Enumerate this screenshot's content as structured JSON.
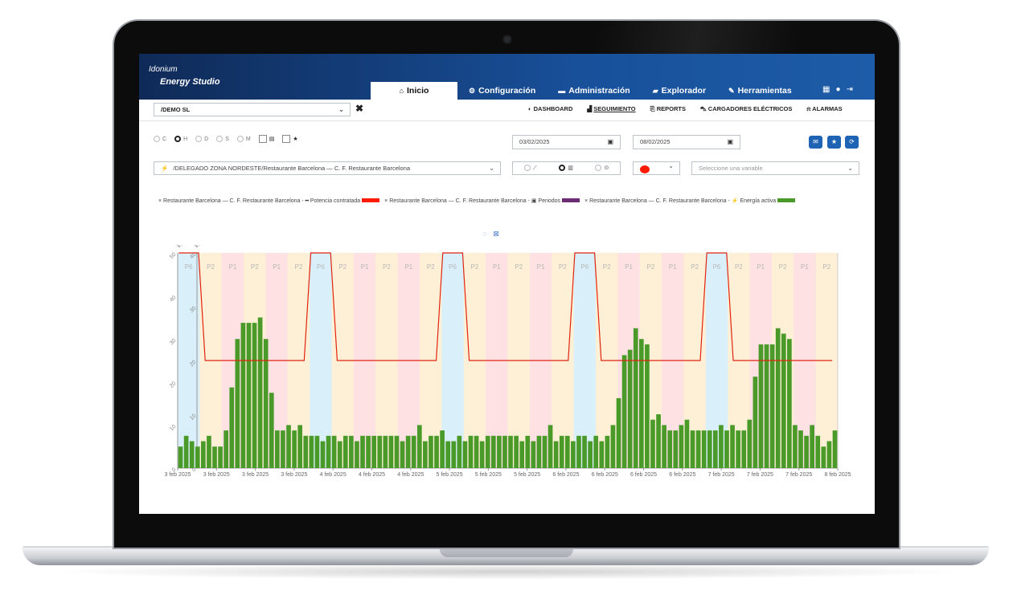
{
  "app": {
    "brand_line1": "Idonium",
    "brand_line2": "Energy Studio"
  },
  "tabs": [
    {
      "icon": "home-icon",
      "label": "Inicio",
      "active": true
    },
    {
      "icon": "gear-icon",
      "label": "Configuración"
    },
    {
      "icon": "card-icon",
      "label": "Administración"
    },
    {
      "icon": "folder-icon",
      "label": "Explorador"
    },
    {
      "icon": "wrench-icon",
      "label": "Herramientas"
    }
  ],
  "company_select": {
    "value": "/DEMO SL"
  },
  "subnav": [
    {
      "icon": "dashboard-icon",
      "label": "DASHBOARD"
    },
    {
      "icon": "chart-area-icon",
      "label": "SEGUIMIENTO",
      "active": true
    },
    {
      "icon": "report-icon",
      "label": "REPORTS"
    },
    {
      "icon": "car-icon",
      "label": "CARGADORES ELÉCTRICOS"
    },
    {
      "icon": "bell-icon",
      "label": "ALARMAS"
    }
  ],
  "granularity": [
    "C",
    "H",
    "D",
    "S",
    "M"
  ],
  "granularity_selected": "H",
  "date_from": "03/02/2025",
  "date_to": "08/02/2025",
  "path_select": "/DELEGADO ZONA NORDESTE/Restaurante Barcelona — C. F. Restaurante Barcelona",
  "variable_select": {
    "placeholder": "Seleccione una variable"
  },
  "legend": [
    {
      "text": "Restaurante Barcelona — C. F. Restaurante Barcelona -",
      "series": "Potencia contratada",
      "color": "#ff1a00"
    },
    {
      "text": "Restaurante Barcelona — C. F. Restaurante Barcelona -",
      "series": "Periodos",
      "color": "#6b2c73"
    },
    {
      "text": "Restaurante Barcelona — C. F. Restaurante Barcelona -",
      "series": "Energía activa",
      "color": "#4a9a2a"
    }
  ],
  "chart_data": {
    "type": "bar",
    "y_left_label": "kW",
    "y_right_label": "kWh",
    "y_left_ticks": [
      0,
      10,
      20,
      30,
      40,
      50
    ],
    "y_right_ticks": [
      0,
      10,
      20,
      30,
      40
    ],
    "x_tick_labels": [
      "3 feb 2025",
      "3 feb 2025",
      "3 feb 2025",
      "3 feb 2025",
      "4 feb 2025",
      "4 feb 2025",
      "4 feb 2025",
      "5 feb 2025",
      "5 feb 2025",
      "5 feb 2025",
      "6 feb 2025",
      "6 feb 2025",
      "6 feb 2025",
      "6 feb 2025",
      "7 feb 2025",
      "7 feb 2025",
      "7 feb 2025",
      "8 feb 2025"
    ],
    "energia_activa_kwh": [
      4,
      6,
      5,
      4,
      5,
      6,
      4,
      4,
      7,
      15,
      24,
      27,
      27,
      27,
      28,
      24,
      14,
      7,
      7,
      8,
      7,
      8,
      6,
      6,
      6,
      5,
      6,
      6,
      5,
      6,
      6,
      5,
      6,
      6,
      6,
      6,
      6,
      6,
      6,
      5,
      6,
      6,
      8,
      5,
      6,
      6,
      7,
      5,
      5,
      6,
      5,
      6,
      6,
      5,
      6,
      6,
      6,
      6,
      6,
      6,
      5,
      6,
      5,
      6,
      6,
      8,
      5,
      6,
      6,
      5,
      6,
      6,
      5,
      6,
      5,
      6,
      8,
      13,
      21,
      22,
      26,
      24,
      23,
      9,
      10,
      8,
      7,
      7,
      8,
      9,
      7,
      7,
      7,
      7,
      7,
      8,
      7,
      8,
      7,
      7,
      9,
      17,
      23,
      23,
      23,
      26,
      25,
      24,
      8,
      7,
      6,
      8,
      6,
      4,
      5,
      7
    ],
    "potencia_contratada_kw": [
      50,
      25
    ],
    "periodos": [
      "P6",
      "P2",
      "P1",
      "P2",
      "P1",
      "P2",
      "P6",
      "P2",
      "P1",
      "P2",
      "P1",
      "P2",
      "P6",
      "P2",
      "P1",
      "P2",
      "P1",
      "P2",
      "P6",
      "P2",
      "P1",
      "P2",
      "P1",
      "P2",
      "P6",
      "P2",
      "P1",
      "P2",
      "P1",
      "P2"
    ],
    "period_colors": {
      "P6": "#d9f0fa",
      "P1": "#fde1e3",
      "P2": "#fdf0d6"
    },
    "ylim_left": [
      0,
      50
    ],
    "ylim_right": [
      0,
      40
    ]
  }
}
